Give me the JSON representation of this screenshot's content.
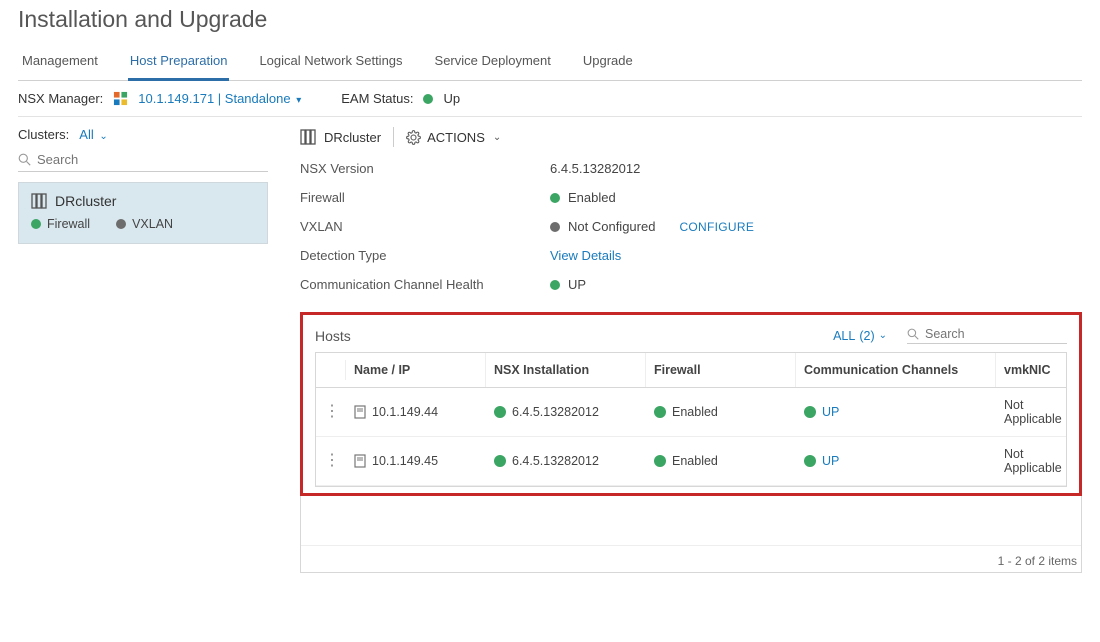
{
  "header": {
    "title": "Installation and Upgrade"
  },
  "tabs": {
    "t0": "Management",
    "t1": "Host Preparation",
    "t2": "Logical Network Settings",
    "t3": "Service Deployment",
    "t4": "Upgrade"
  },
  "subbar": {
    "nsx_label": "NSX Manager:",
    "nsx_ip": "10.1.149.171",
    "nsx_mode": "Standalone",
    "eam_label": "EAM Status:",
    "eam_status": "Up"
  },
  "sidebar": {
    "clusters_label": "Clusters:",
    "clusters_filter": "All",
    "search_placeholder": "Search",
    "cluster": {
      "name": "DRcluster",
      "firewall_label": "Firewall",
      "vxlan_label": "VXLAN"
    }
  },
  "details": {
    "cluster_name": "DRcluster",
    "actions_label": "ACTIONS",
    "rows": {
      "ver_k": "NSX Version",
      "ver_v": "6.4.5.13282012",
      "fw_k": "Firewall",
      "fw_v": "Enabled",
      "vx_k": "VXLAN",
      "vx_v": "Not Configured",
      "vx_action": "CONFIGURE",
      "dt_k": "Detection Type",
      "dt_link": "View Details",
      "cc_k": "Communication Channel Health",
      "cc_v": "UP"
    }
  },
  "hosts": {
    "title": "Hosts",
    "filter_label_prefix": "ALL",
    "filter_count": "(2)",
    "search_placeholder": "Search",
    "columns": {
      "c1": "Name / IP",
      "c2": "NSX Installation",
      "c3": "Firewall",
      "c4": "Communication Channels",
      "c5": "vmkNIC"
    },
    "rows": [
      {
        "ip": "10.1.149.44",
        "nsx": "6.4.5.13282012",
        "fw": "Enabled",
        "cc": "UP",
        "vmk": "Not Applicable"
      },
      {
        "ip": "10.1.149.45",
        "nsx": "6.4.5.13282012",
        "fw": "Enabled",
        "cc": "UP",
        "vmk": "Not Applicable"
      }
    ],
    "footer": "1 - 2 of 2 items"
  }
}
